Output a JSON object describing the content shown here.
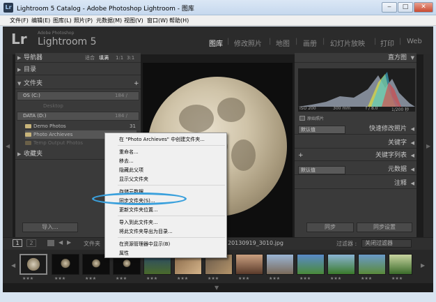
{
  "window": {
    "title": "Lightroom 5 Catalog - Adobe Photoshop Lightroom - 图库",
    "app_icon": "Lr",
    "minimize_icon": "‒",
    "maximize_icon": "□",
    "close_icon": "✕"
  },
  "menu": [
    "文件(F)",
    "编辑(E)",
    "图库(L)",
    "照片(P)",
    "元数据(M)",
    "视图(V)",
    "窗口(W)",
    "帮助(H)"
  ],
  "brand": {
    "logo": "Lr",
    "small": "Adobe Photoshop",
    "big": "Lightroom 5"
  },
  "modules": [
    {
      "label": "图库",
      "active": true
    },
    {
      "label": "修改照片",
      "active": false
    },
    {
      "label": "地图",
      "active": false
    },
    {
      "label": "画册",
      "active": false
    },
    {
      "label": "幻灯片放映",
      "active": false
    },
    {
      "label": "打印",
      "active": false
    },
    {
      "label": "Web",
      "active": false
    }
  ],
  "module_separator": "|",
  "left_panel": {
    "navigator": {
      "label": "导航器",
      "fit": "适合",
      "fill": "填满",
      "r1": "1:1",
      "r3": "3:1"
    },
    "catalog": {
      "label": "目录"
    },
    "folders": {
      "label": "文件夹",
      "add": "+"
    },
    "volumes": [
      {
        "label": "OS (C:)",
        "info": "184 / "
      },
      {
        "label": "DATA (D:)",
        "info": "184 / "
      }
    ],
    "desktop": "Desktop",
    "folder_items": [
      {
        "label": "Demo Photos",
        "count": "31"
      },
      {
        "label": "Photo Archieves",
        "count": ""
      },
      {
        "label": "Temp Output Photos",
        "count": ""
      }
    ],
    "collections": {
      "label": "收藏夹",
      "add": "+"
    },
    "import_button": "导入..."
  },
  "right_panel": {
    "histogram_title": "直方图",
    "exif": {
      "iso": "ISO 200",
      "focal": "300 mm",
      "aperture": "f / 8.0",
      "shutter": "1/200 秒"
    },
    "original_photo": "原始照片",
    "quick_develop": {
      "preset": "默认值",
      "label": "快速修改照片"
    },
    "keywording": "关键字",
    "keyword_list": {
      "add": "+",
      "label": "关键字列表"
    },
    "metadata": {
      "preset": "默认值",
      "label": "元数据"
    },
    "comments": "注释",
    "sync_button": "同步",
    "sync_settings_button": "同步设置"
  },
  "toolbar": {
    "page1": "1",
    "page2": "2",
    "folder_label": "文件夹",
    "filename": "20130919_3010.jpg",
    "filter_label": "过滤器 :",
    "filter_value": "关闭过滤器",
    "back_icon": "◀",
    "forward_icon": "▶",
    "dropdown_icon": "▾"
  },
  "filmstrip": {
    "stars": "★★★",
    "thumb_count": 13
  },
  "context_menu": {
    "items": [
      "在 \"Photo Archieves\" 中创建文件夹...",
      "重命名...",
      "移去...",
      "隐藏此父项",
      "显示父文件夹",
      "存储元数据",
      "同步文件夹(S)...",
      "更新文件夹位置...",
      "导入到此文件夹...",
      "将此文件夹导出为目录...",
      "在资源管理器中显示(B)",
      "属性"
    ]
  },
  "colors": {
    "lr_background": "#2b2b2b",
    "panel": "#3a3a3a",
    "highlight_ring": "#3aa0dc",
    "menu_bg": "#f0f0f0"
  }
}
